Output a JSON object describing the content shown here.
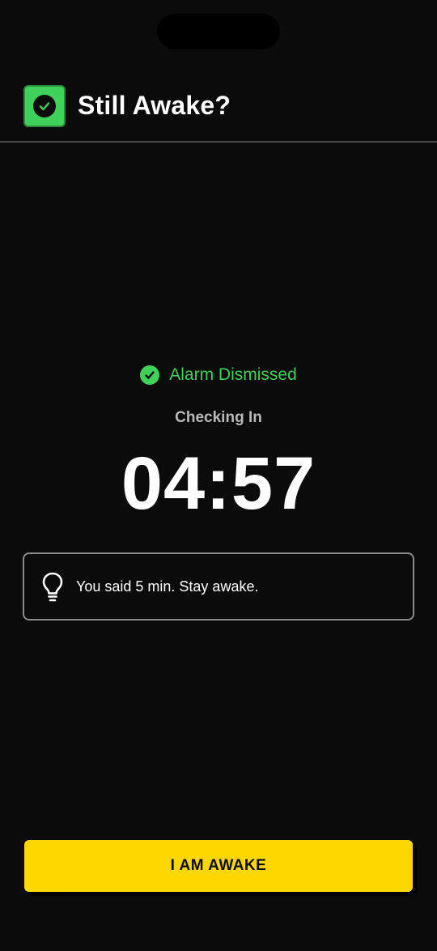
{
  "header": {
    "title": "Still Awake?",
    "icon": "check-badge-icon",
    "icon_color": "#3fd15a"
  },
  "status": {
    "icon": "check-circle-icon",
    "text": "Alarm Dismissed",
    "color": "#3fd15a"
  },
  "checkin": {
    "label": "Checking In",
    "timer": "04:57"
  },
  "tip": {
    "icon": "lightbulb-icon",
    "text": "You said 5 min. Stay awake."
  },
  "action": {
    "label": "I AM AWAKE",
    "color": "#ffd700"
  }
}
